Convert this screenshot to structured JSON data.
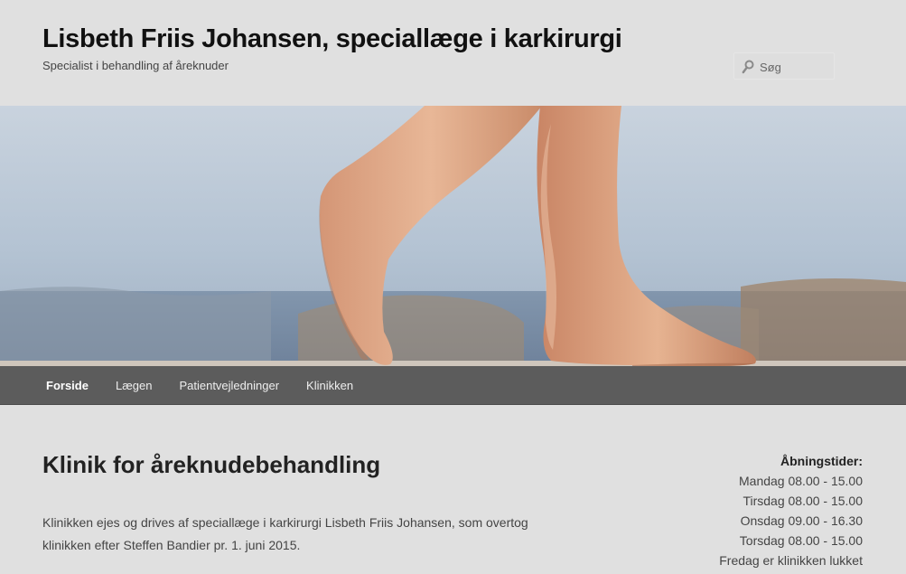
{
  "header": {
    "site_title": "Lisbeth Friis Johansen, speciallæge i karkirurgi",
    "site_description": "Specialist i behandling af åreknuder",
    "search_placeholder": "Søg"
  },
  "nav": {
    "items": [
      {
        "label": "Forside"
      },
      {
        "label": "Lægen"
      },
      {
        "label": "Patientvejledninger"
      },
      {
        "label": "Klinikken"
      }
    ]
  },
  "main": {
    "title": "Klinik for åreknudebehandling",
    "paragraph": "Klinikken ejes og drives af speciallæge i karkirurgi Lisbeth Friis Johansen, som overtog klinikken efter Steffen Bandier pr. 1. juni 2015."
  },
  "hours": {
    "title": "Åbningstider:",
    "rows": [
      "Mandag 08.00 - 15.00",
      "Tirsdag 08.00 - 15.00",
      "Onsdag 09.00 - 16.30",
      "Torsdag 08.00 - 15.00",
      "Fredag er klinikken lukket"
    ]
  },
  "colors": {
    "nav_bg": "#5c5c5c",
    "page_bg": "#e0e0e0"
  }
}
